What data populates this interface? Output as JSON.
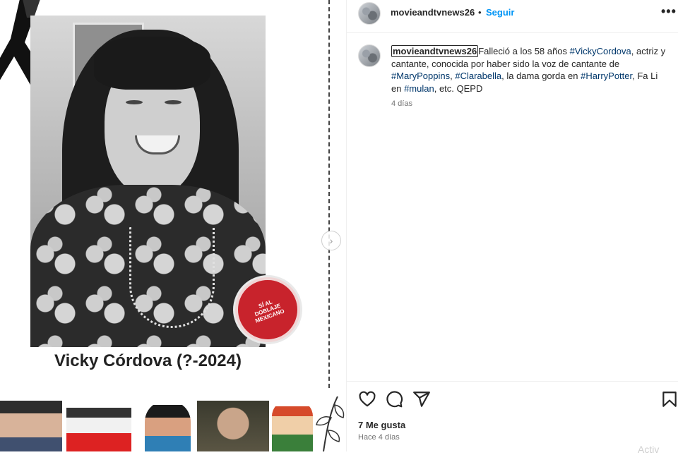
{
  "media": {
    "title": "Vicky Córdova (?-2024)",
    "badge_text": "SÍ AL DOBLAJE MEXICANO",
    "next_icon": "chevron-right-icon"
  },
  "header": {
    "username": "movieandtvnews26",
    "separator": "•",
    "follow_label": "Seguir",
    "more_label": "•••"
  },
  "comment": {
    "username": "movieandtvnews26",
    "text_1": "Falleció a los 58 años ",
    "tag_1": "#VickyCordova",
    "text_2": ", actriz y cantante, conocida por haber sido la voz de cantante de ",
    "tag_2": "#MaryPoppins",
    "text_3": ", ",
    "tag_3": "#Clarabella",
    "text_4": ", la dama gorda en ",
    "tag_4": "#HarryPotter",
    "text_5": ", Fa Li en ",
    "tag_5": "#mulan",
    "text_6": ", etc. QEPD",
    "time": "4 días"
  },
  "actions": {
    "likes": "7 Me gusta",
    "post_time": "Hace 4 días",
    "watermark": "Activ"
  },
  "colors": {
    "follow": "#0095f6",
    "hashtag": "#00376b",
    "badge": "#c8232c"
  }
}
